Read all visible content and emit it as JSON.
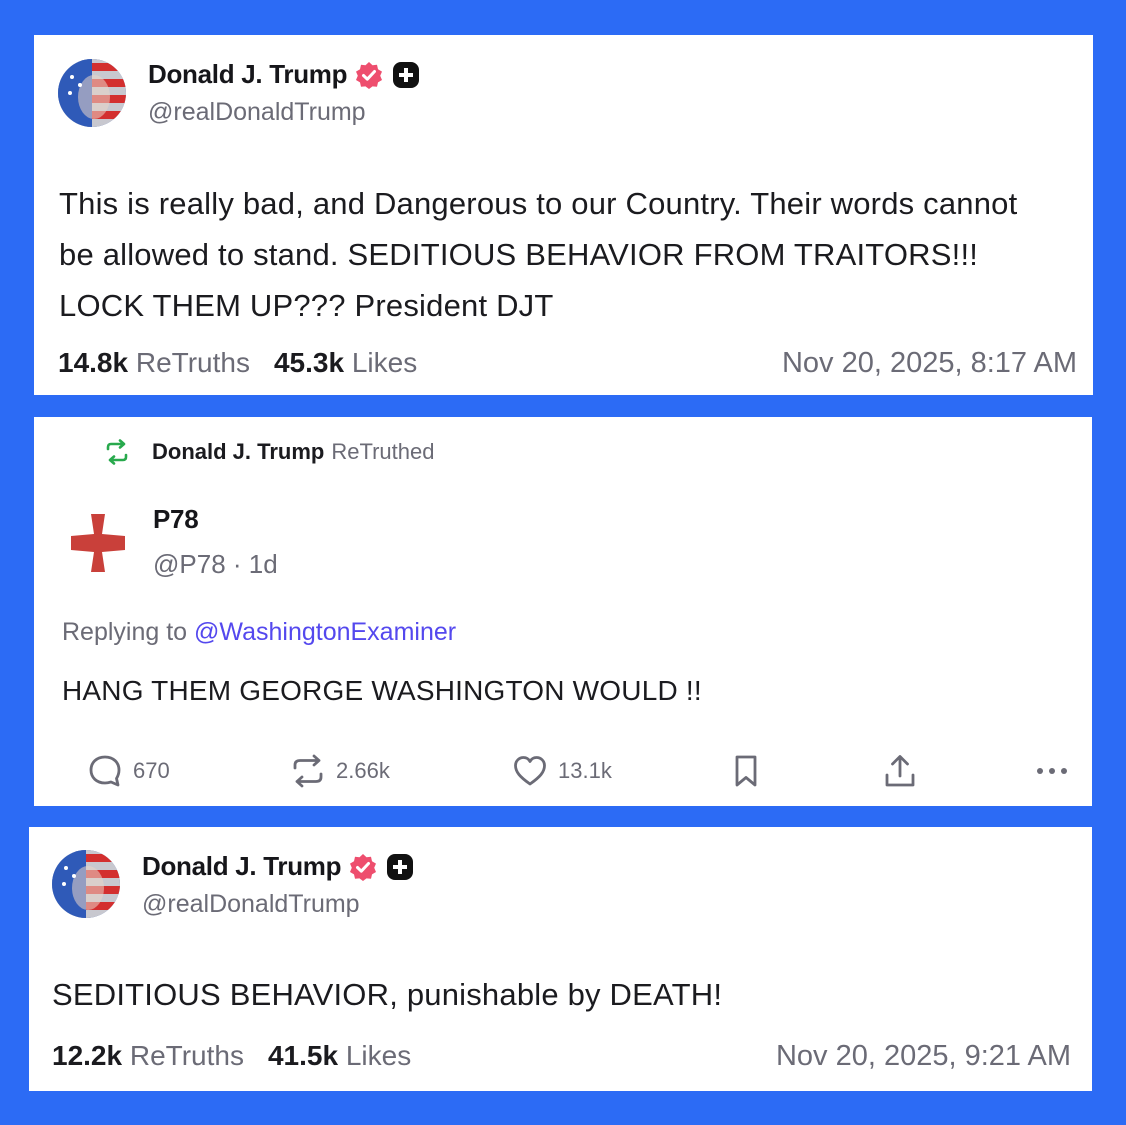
{
  "post1": {
    "author_name": "Donald J. Trump",
    "handle": "@realDonaldTrump",
    "text": "This is really bad, and Dangerous to our Country. Their words cannot be allowed to stand. SEDITIOUS BEHAVIOR FROM TRAITORS!!! LOCK THEM UP??? President DJT",
    "retruths_count": "14.8k",
    "retruths_label": "ReTruths",
    "likes_count": "45.3k",
    "likes_label": "Likes",
    "date": "Nov 20, 2025, 8:17 AM"
  },
  "post2": {
    "retruthed_by": "Donald J. Trump",
    "retruthed_label": "ReTruthed",
    "author_name": "P78",
    "handle_time": "@P78 · 1d",
    "replying_prefix": "Replying to",
    "replying_to": "@WashingtonExaminer",
    "text": "HANG THEM GEORGE WASHINGTON WOULD !!",
    "replies": "670",
    "retruths": "2.66k",
    "likes": "13.1k"
  },
  "post3": {
    "author_name": "Donald J. Trump",
    "handle": "@realDonaldTrump",
    "text": "SEDITIOUS BEHAVIOR, punishable by DEATH!",
    "retruths_count": "12.2k",
    "retruths_label": "ReTruths",
    "likes_count": "41.5k",
    "likes_label": "Likes",
    "date": "Nov 20, 2025, 9:21 AM"
  },
  "icons": {
    "verified": "verified-badge-icon",
    "plus": "plus-badge-icon",
    "retruth": "retruth-icon",
    "reply": "comment-icon",
    "like": "heart-icon",
    "bookmark": "bookmark-icon",
    "share": "share-icon",
    "more": "more-icon"
  },
  "colors": {
    "background": "#2c6bf5",
    "verified": "#ee4e6e",
    "retruth_green": "#28a94d",
    "mention": "#5448ee",
    "p78_cross": "#c9403a"
  }
}
